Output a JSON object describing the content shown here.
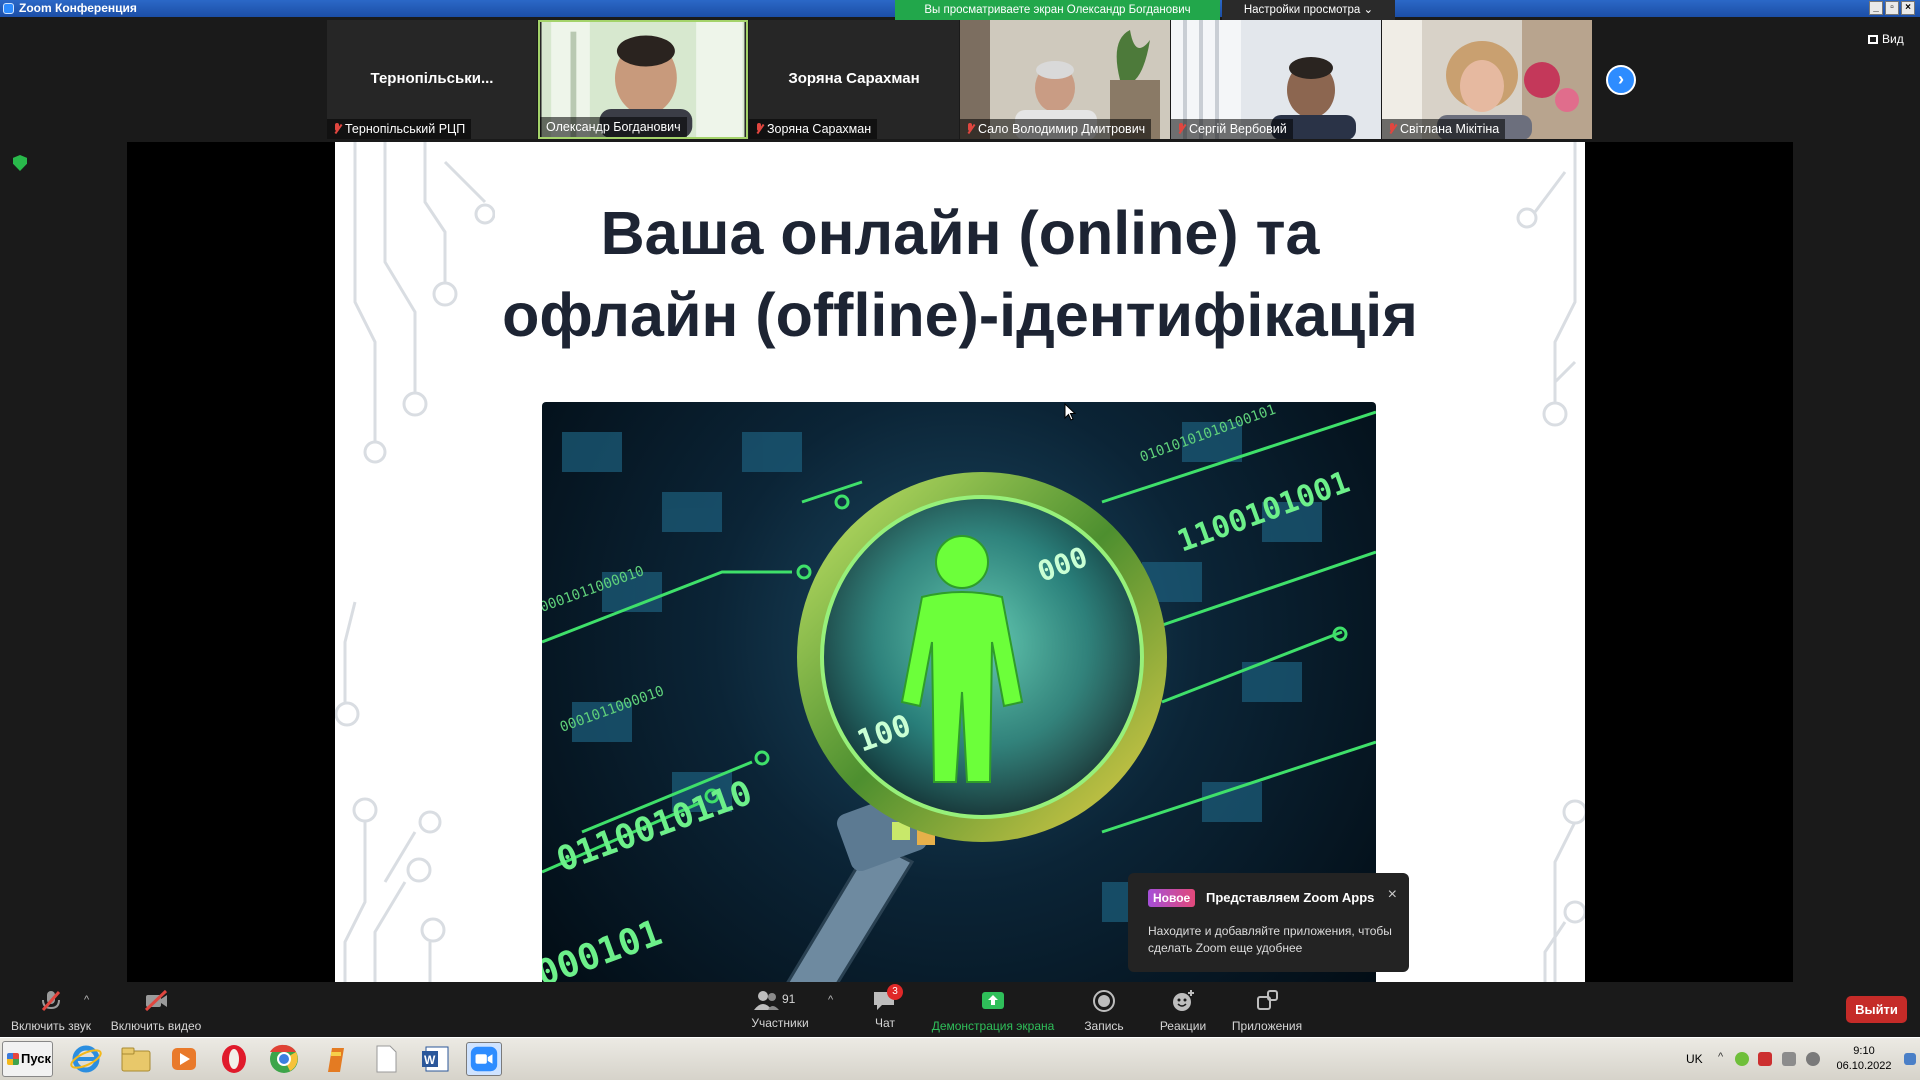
{
  "window": {
    "title": "Zoom Конференция",
    "share_banner": "Вы просматриваете экран Олександр Богданович",
    "view_options": "Настройки просмотра ⌄",
    "min": "_",
    "max": "▫",
    "close": "×"
  },
  "gallery": {
    "tiles": [
      {
        "center_name": "Тернопільськи...",
        "name": "Тернопільський РЦП"
      },
      {
        "name": "Олександр Богданович"
      },
      {
        "center_name": "Зоряна Сарахман",
        "name": "Зоряна Сарахман"
      },
      {
        "name": "Сало Володимир Дмитрович"
      },
      {
        "name": "Сергій Вербовий"
      },
      {
        "name": "Світлана Мікітіна"
      }
    ],
    "next_glyph": "›",
    "view_label": "Вид"
  },
  "slide": {
    "title_line1": "Ваша онлайн (online) та",
    "title_line2": "офлайн (offline)-ідентифікація",
    "binary": {
      "a": "1100101001",
      "b": "000",
      "c": "100",
      "d": "0110010110",
      "e": "000101",
      "f": "0001011000010",
      "g": "01010101010100101"
    }
  },
  "popup": {
    "badge": "Новое",
    "title": "Представляем Zoom Apps",
    "close": "×",
    "text": "Находите и добавляйте приложения, чтобы сделать Zoom еще удобнее"
  },
  "toolbar": {
    "unmute": "Включить звук",
    "video": "Включить видео",
    "participants": "Участники",
    "participants_count": "91",
    "chat": "Чат",
    "chat_badge": "3",
    "share": "Демонстрация экрана",
    "record": "Запись",
    "reactions": "Реакции",
    "apps": "Приложения",
    "leave": "Выйти",
    "caret": "^"
  },
  "taskbar": {
    "start": "Пуск",
    "lang": "UK",
    "time": "9:10",
    "date": "06.10.2022",
    "tray_caret": "^"
  },
  "colors": {
    "zoom_blue": "#2d8cff",
    "share_green": "#22a74b",
    "leave_red": "#c52b28"
  }
}
